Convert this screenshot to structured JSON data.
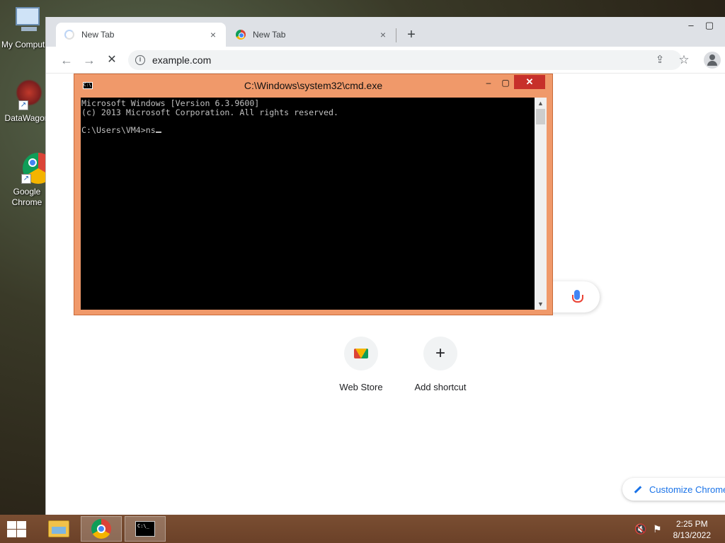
{
  "desktop": {
    "icons": [
      {
        "label": "My Computer"
      },
      {
        "label": "DataWagon"
      },
      {
        "label_line1": "Google",
        "label_line2": "Chrome"
      }
    ]
  },
  "browser": {
    "tabs": [
      {
        "title": "New Tab",
        "close": "×"
      },
      {
        "title": "New Tab",
        "close": "×"
      }
    ],
    "new_tab": "+",
    "window_controls": {
      "minimize": "–",
      "maximize": "▢"
    },
    "toolbar": {
      "back": "←",
      "forward": "→",
      "stop": "✕",
      "url": "example.com",
      "share": "⇪",
      "bookmark": "☆"
    },
    "page": {
      "shortcuts": [
        {
          "label": "Web Store"
        },
        {
          "label": "Add shortcut",
          "icon_text": "+"
        }
      ],
      "customize_label": "Customize Chrome"
    }
  },
  "cmd": {
    "title": "C:\\Windows\\system32\\cmd.exe",
    "controls": {
      "minimize": "–",
      "maximize": "▢",
      "close": "✕"
    },
    "lines": [
      "Microsoft Windows [Version 6.3.9600]",
      "(c) 2013 Microsoft Corporation. All rights reserved.",
      "",
      "C:\\Users\\VM4>ns"
    ],
    "scroll_up": "▲",
    "scroll_down": "▼"
  },
  "taskbar": {
    "time": "2:25 PM",
    "date": "8/13/2022",
    "tray": {
      "volume": "🔇",
      "network": "⚑"
    }
  }
}
